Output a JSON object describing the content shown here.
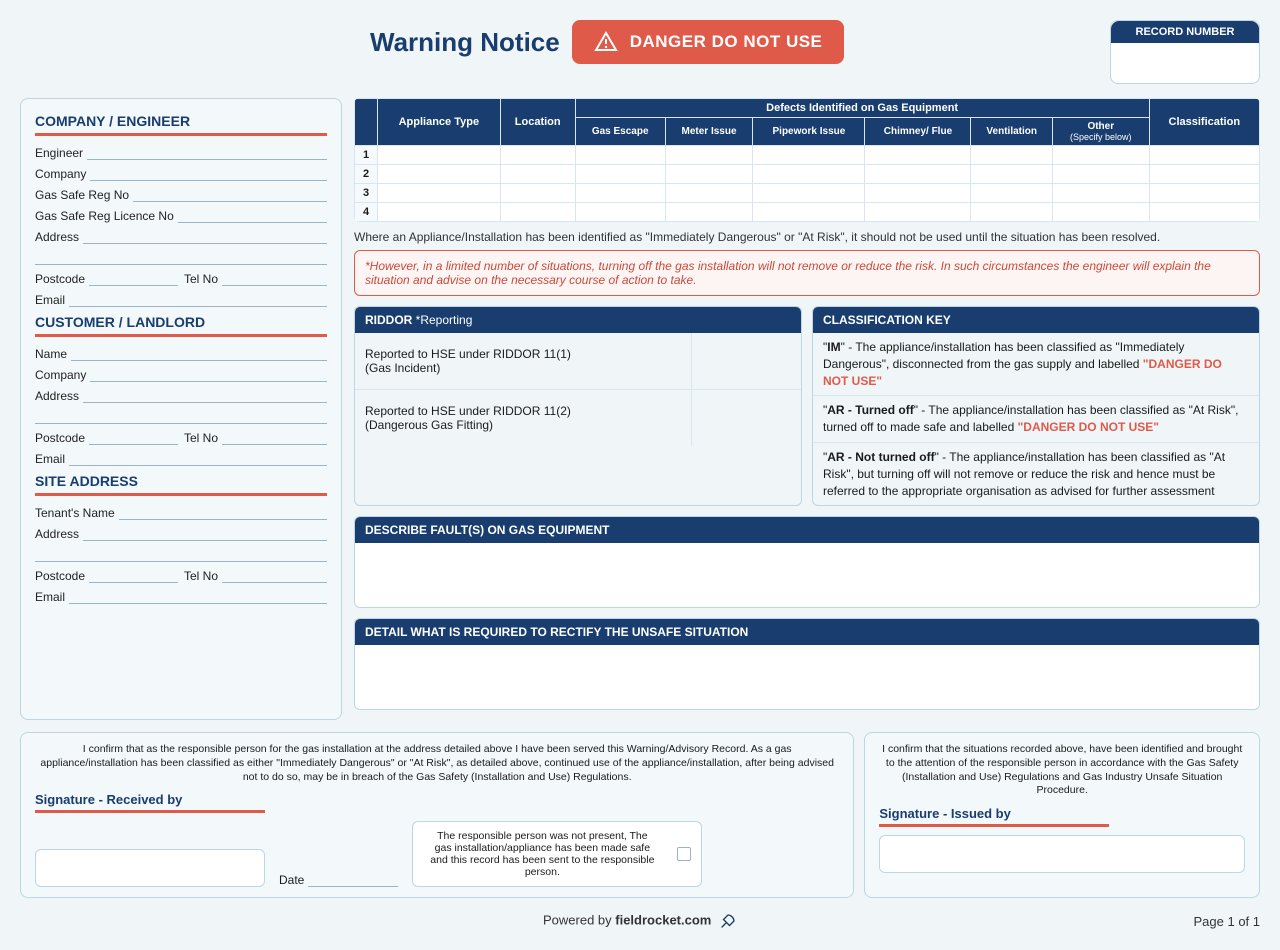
{
  "header": {
    "title": "Warning Notice",
    "danger_label": "DANGER DO NOT USE",
    "record_number_label": "RECORD NUMBER"
  },
  "sections": {
    "company": {
      "title": "COMPANY / ENGINEER",
      "engineer": "Engineer",
      "company": "Company",
      "gas_safe_reg_no": "Gas Safe Reg No",
      "gas_safe_licence_no": "Gas Safe Reg Licence No",
      "address": "Address",
      "postcode": "Postcode",
      "tel_no": "Tel No",
      "email": "Email"
    },
    "customer": {
      "title": "CUSTOMER / LANDLORD",
      "name": "Name",
      "company": "Company",
      "address": "Address",
      "postcode": "Postcode",
      "tel_no": "Tel No",
      "email": "Email"
    },
    "site": {
      "title": "SITE ADDRESS",
      "tenant_name": "Tenant's Name",
      "address": "Address",
      "postcode": "Postcode",
      "tel_no": "Tel No",
      "email": "Email"
    }
  },
  "defects_table": {
    "appliance_type": "Appliance Type",
    "location": "Location",
    "defects_header": "Defects Identified on Gas Equipment",
    "classification": "Classification",
    "cols": {
      "gas_escape": "Gas Escape",
      "meter_issue": "Meter Issue",
      "pipework_issue": "Pipework Issue",
      "chimney_flue": "Chimney/ Flue",
      "ventilation": "Ventilation",
      "other": "Other",
      "other_sub": "(Specify below)"
    },
    "rows": [
      "1",
      "2",
      "3",
      "4"
    ]
  },
  "note": "Where an Appliance/Installation has been identified as \"Immediately Dangerous\" or \"At Risk\", it should not be used until the situation has been resolved.",
  "warn": "*However, in a limited number of situations, turning off the gas installation will not remove or reduce the risk. In such circumstances the engineer will explain the situation and advise on the necessary course of action to take.",
  "riddor": {
    "head": "RIDDOR ",
    "head_sub": "*Reporting",
    "row1a": "Reported to HSE under RIDDOR 11(1)",
    "row1b": "(Gas Incident)",
    "row2a": "Reported to HSE under RIDDOR 11(2)",
    "row2b": "(Dangerous Gas Fitting)"
  },
  "classkey": {
    "head": "CLASSIFICATION KEY",
    "im_code": "IM",
    "im_text": "\" - The appliance/installation has been classified as \"Immediately Dangerous\", disconnected from the gas supply and labelled ",
    "im_red": "\"DANGER DO NOT USE\"",
    "ar_off_code": "AR - Turned off",
    "ar_off_text": "\" - The appliance/installation has been classified as \"At Risk\", turned off to made safe and labelled  ",
    "ar_off_red": "\"DANGER DO NOT USE\"",
    "ar_not_code": "AR - Not turned off",
    "ar_not_text": "\" - The appliance/installation has been classified as \"At Risk\", but turning off will not remove or reduce the risk and hence must be referred to the appropriate organisation as advised for further assessment"
  },
  "describe_faults": "DESCRIBE FAULT(S) ON GAS EQUIPMENT",
  "detail_rectify": "DETAIL WHAT IS REQUIRED TO RECTIFY THE UNSAFE SITUATION",
  "bottom": {
    "left_disclaim": "I confirm that as the responsible person for the gas installation at the address detailed above I have been served this Warning/Advisory Record. As a gas appliance/installation has been classified as either \"Immediately Dangerous\" or \"At Risk\", as detailed above, continued use of the appliance/installation, after being advised not to do so, may be in breach of the Gas Safety (Installation and Use) Regulations.",
    "sig_received": "Signature - Received by",
    "date": "Date",
    "not_present": "The responsible person was not present, The gas installation/appliance has been made safe and this record has been sent to the responsible person.",
    "right_disclaim": "I confirm that the situations recorded above, have been identified and brought to the attention of the responsible person in accordance with the Gas Safety (Installation and Use) Regulations and Gas Industry Unsafe Situation Procedure.",
    "sig_issued": "Signature - Issued by"
  },
  "footer": {
    "powered_pre": "Powered by ",
    "powered_site": "fieldrocket.com",
    "page": "Page 1 of 1"
  }
}
